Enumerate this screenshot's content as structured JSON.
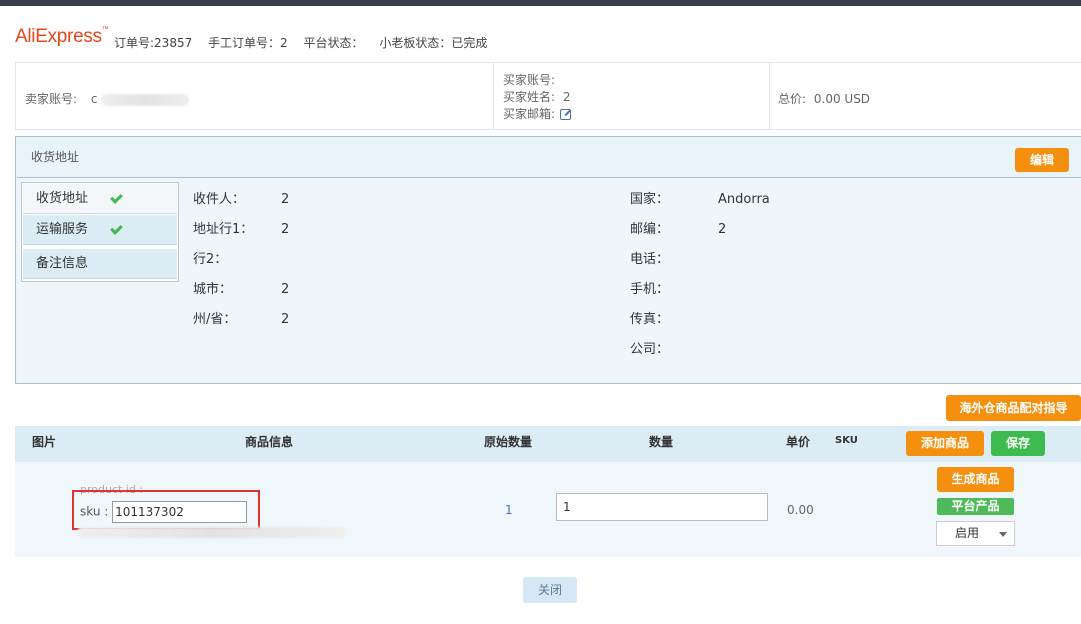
{
  "header": {
    "logo_text": "AliExpress",
    "order_no": "订单号:23857",
    "manual_order_no": "手工订单号：2",
    "platform_status": "平台状态：",
    "board_status": "小老板状态：已完成"
  },
  "info": {
    "seller_label": "卖家账号:",
    "seller_value": "c",
    "buyer_account_label": "买家账号:",
    "buyer_name_label": "买家姓名:",
    "buyer_name_value": "2",
    "buyer_email_label": "买家邮箱:",
    "total_label": "总价:",
    "total_value": "0.00 USD"
  },
  "address": {
    "panel_title": "收货地址",
    "edit_button": "编辑",
    "tabs": [
      {
        "label": "收货地址",
        "checked": true
      },
      {
        "label": "运输服务",
        "checked": true
      },
      {
        "label": "备注信息",
        "checked": false
      }
    ],
    "left_fields": [
      {
        "label": "收件人：",
        "value": "2"
      },
      {
        "label": "地址行1：",
        "value": "2"
      },
      {
        "label": "行2：",
        "value": ""
      },
      {
        "label": "城市：",
        "value": "2"
      },
      {
        "label": "州/省：",
        "value": "2"
      }
    ],
    "right_fields": [
      {
        "label": "国家：",
        "value": "Andorra"
      },
      {
        "label": "邮编：",
        "value": "2"
      },
      {
        "label": "电话：",
        "value": ""
      },
      {
        "label": "手机：",
        "value": ""
      },
      {
        "label": "传真：",
        "value": ""
      },
      {
        "label": "公司：",
        "value": ""
      }
    ]
  },
  "guide_button": "海外仓商品配对指导",
  "table": {
    "headers": {
      "image": "图片",
      "product_info": "商品信息",
      "original_qty": "原始数量",
      "quantity": "数量",
      "unit_price": "单价",
      "sku": "SKU"
    },
    "add_product_button": "添加商品",
    "save_button": "保存",
    "row": {
      "product_id_label": "product id :",
      "sku_label": "sku :",
      "sku_value": "101137302",
      "original_qty": "1",
      "quantity_value": "1",
      "unit_price": "0.00",
      "generate_button": "生成商品",
      "platform_badge": "平台产品",
      "status_select": "启用"
    }
  },
  "close_button": "关闭",
  "colors": {
    "orange": "#f5900f",
    "green": "#3dbb4e",
    "panel_bg": "#e8f4fa",
    "highlight_red": "#e03232"
  }
}
